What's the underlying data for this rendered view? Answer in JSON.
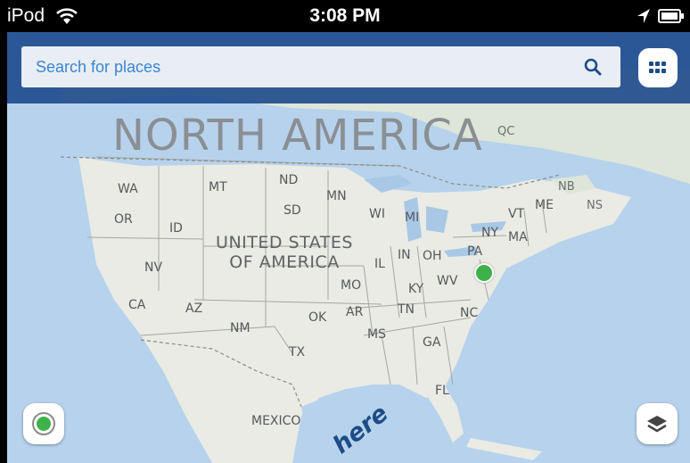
{
  "status_bar": {
    "carrier": "iPod",
    "time": "3:08 PM"
  },
  "search": {
    "placeholder": "Search for places"
  },
  "map": {
    "continent_label": "NORTH AMERICA",
    "country_label_line1": "UNITED STATES",
    "country_label_line2": "OF AMERICA",
    "mexico_label": "MEXICO",
    "province_labels": [
      "QC",
      "NB",
      "NS"
    ],
    "state_labels": [
      "WA",
      "MT",
      "ND",
      "MN",
      "OR",
      "ID",
      "SD",
      "WI",
      "MI",
      "NY",
      "VT",
      "ME",
      "MA",
      "NV",
      "PA",
      "IL",
      "IN",
      "OH",
      "CA",
      "AZ",
      "MO",
      "KY",
      "WV",
      "OK",
      "AR",
      "TN",
      "NC",
      "NM",
      "TX",
      "MS",
      "GA",
      "FL"
    ],
    "watermark": "here",
    "current_location_color": "#3fb14a"
  },
  "colors": {
    "header": "#18458a",
    "accent": "#3c84d2",
    "water": "#b7d2ec",
    "land": "#e9ebe4"
  },
  "icons": [
    "wifi-icon",
    "location-arrow-icon",
    "battery-icon",
    "search-icon",
    "grid-menu-icon",
    "locate-me-icon",
    "layers-icon"
  ]
}
